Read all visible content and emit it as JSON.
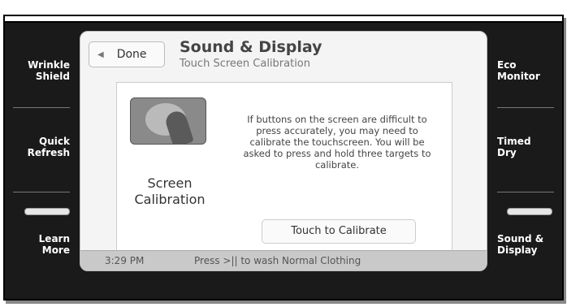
{
  "left_menu": [
    {
      "line1": "Wrinkle",
      "line2": "Shield"
    },
    {
      "line1": "Quick",
      "line2": "Refresh"
    },
    {
      "line1": "Learn",
      "line2": "More"
    }
  ],
  "right_menu": [
    {
      "line1": "Eco",
      "line2": "Monitor"
    },
    {
      "line1": "Timed",
      "line2": "Dry"
    },
    {
      "line1": "Sound &",
      "line2": "Display"
    }
  ],
  "header": {
    "done_label": "Done",
    "title": "Sound & Display",
    "subtitle": "Touch Screen Calibration"
  },
  "content": {
    "icon_name": "touch-calibration-icon",
    "label_line1": "Screen",
    "label_line2": "Calibration",
    "description": "If buttons on the screen are difficult to press accurately, you may need to calibrate the touchscreen. You will be asked to press and hold three targets to calibrate.",
    "button_label": "Touch to Calibrate"
  },
  "status": {
    "time": "3:29 PM",
    "message": "Press >|| to wash Normal Clothing"
  }
}
